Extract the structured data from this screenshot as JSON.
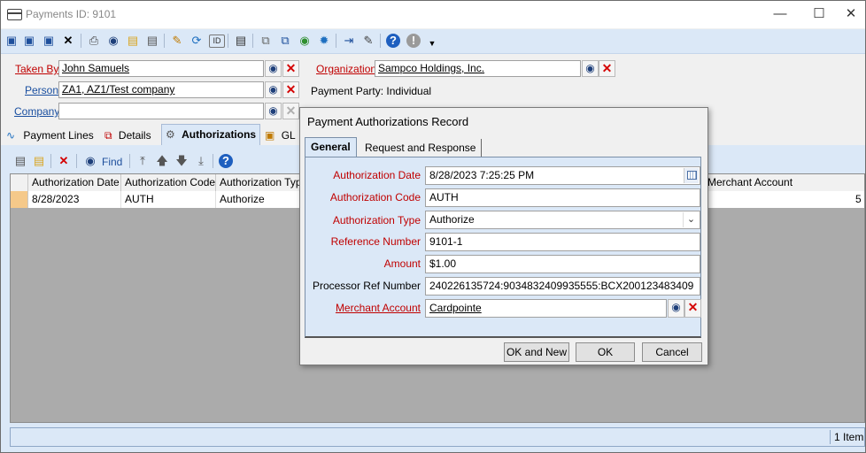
{
  "window": {
    "title": "Payments ID: 9101"
  },
  "toolbar": {
    "icons": [
      "save-icon",
      "save-close-icon",
      "save-new-icon",
      "delete-icon",
      "print-icon",
      "find-icon",
      "open-folder-icon",
      "notes-icon",
      "edit-icon",
      "refresh-icon",
      "id-icon",
      "link-icon",
      "copy-icon",
      "apply-icon",
      "globe-icon",
      "spinner-icon",
      "import-icon",
      "label-icon",
      "help-icon",
      "info-icon"
    ]
  },
  "form": {
    "taken_by_label": "Taken By",
    "taken_by_value": "John Samuels",
    "organization_label": "Organization",
    "organization_value": "Sampco Holdings, Inc.",
    "person_label": "Person",
    "person_value": "ZA1, AZ1/Test company",
    "payment_party_text": "Payment Party: Individual",
    "company_label": "Company",
    "company_value": ""
  },
  "tabs": [
    {
      "label": "Payment Lines"
    },
    {
      "label": "Details"
    },
    {
      "label": "Authorizations"
    },
    {
      "label": "GL"
    }
  ],
  "grid_toolbar": {
    "find_label": "Find"
  },
  "grid": {
    "columns": [
      "Authorization Date",
      "Authorization Code",
      "Authorization Type",
      "Merchant Account"
    ],
    "rows": [
      {
        "date": "8/28/2023",
        "code": "AUTH",
        "type": "Authorize",
        "tail": "5"
      }
    ]
  },
  "status": {
    "count": "1 Item"
  },
  "dialog": {
    "title": "Payment Authorizations Record",
    "tabs": [
      "General",
      "Request and Response"
    ],
    "fields": {
      "auth_date_label": "Authorization Date",
      "auth_date_value": "8/28/2023 7:25:25 PM",
      "auth_code_label": "Authorization Code",
      "auth_code_value": "AUTH",
      "auth_type_label": "Authorization Type",
      "auth_type_value": "Authorize",
      "ref_number_label": "Reference Number",
      "ref_number_value": "9101-1",
      "amount_label": "Amount",
      "amount_value": "$1.00",
      "processor_ref_label": "Processor Ref Number",
      "processor_ref_value": "240226135724:9034832409935555:BCX200123483409",
      "merchant_label": "Merchant Account",
      "merchant_value": "Cardpointe"
    },
    "buttons": {
      "ok_new": "OK and New",
      "ok": "OK",
      "cancel": "Cancel"
    }
  }
}
